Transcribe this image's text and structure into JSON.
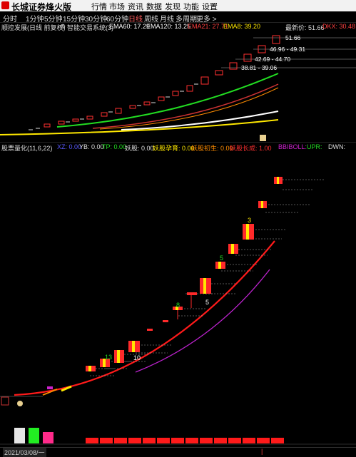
{
  "app": {
    "title": "长城证券烽火版"
  },
  "menu": [
    "行情",
    "市场",
    "资讯",
    "数据",
    "发现",
    "功能",
    "设置"
  ],
  "periods": [
    "分时",
    "1分钟",
    "5分钟",
    "15分钟",
    "30分钟",
    "60分钟",
    "日线",
    "周线",
    "月线",
    "多周期",
    "更多 >"
  ],
  "active_period": "日线",
  "main_info": {
    "stock_name": "顺控发展(日线 前复权)",
    "system": "智能交易系统(3)",
    "ema60": "EMA60: 17.29",
    "ema120": "EMA120: 13.25",
    "ema21": "EMA21: 27.71",
    "ema8": "EMA8: 39.20",
    "latest": "最新价: 51.66",
    "dkx": "DKX: 30.48"
  },
  "price_labels": {
    "l1": "51.66",
    "l2": "46.96 - 49.31",
    "l3": "42.69 - 44.70",
    "l4": "38.81 - 39.06"
  },
  "ind_info": {
    "name": "股票量化(11,6,22)",
    "xz": "XZ: 0.00",
    "yb": "YB: 0.00",
    "tp": "TP: 0.00",
    "yaogu": "妖股: 0.00",
    "yunyu": "妖股孕育: 0.00",
    "chusheng": "妖股初生: 0.00",
    "zhangcheng": "妖股长成: 1.00",
    "boll": "BBIBOLL:",
    "upr": "UPR:",
    "dwn": "DWN:"
  },
  "signal_numbers": [
    "13",
    "10",
    "8",
    "5",
    "5",
    "3"
  ],
  "footer": {
    "date": "2021/03/08/一"
  },
  "colors": {
    "up": "#ff2a2a",
    "yellow": "#ffe800",
    "green": "#22dd22",
    "magenta": "#cc22cc",
    "white": "#ffffff",
    "orange": "#ff8c00"
  }
}
